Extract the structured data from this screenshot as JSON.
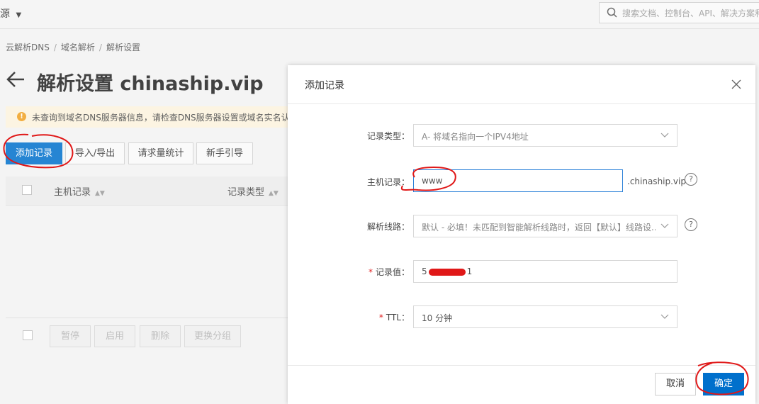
{
  "topbar": {
    "menu_label": "源",
    "search_placeholder": "搜索文档、控制台、API、解决方案和"
  },
  "breadcrumb": [
    "云解析DNS",
    "域名解析",
    "解析设置"
  ],
  "page_title": "解析设置 chinaship.vip",
  "notice": "未查询到域名DNS服务器信息，请检查DNS服务器设置或域名实名认",
  "toolbar": {
    "add_record": "添加记录",
    "import_export": "导入/导出",
    "request_stats": "请求量统计",
    "beginner_guide": "新手引导"
  },
  "table": {
    "columns": [
      "主机记录",
      "记录类型"
    ]
  },
  "batch": {
    "pause": "暂停",
    "enable": "启用",
    "delete": "删除",
    "change_group": "更换分组"
  },
  "dialog": {
    "title": "添加记录",
    "fields": {
      "record_type": {
        "label": "记录类型：",
        "value": "A- 将域名指向一个IPV4地址"
      },
      "host": {
        "label": "主机记录：",
        "value": "www",
        "suffix": ".chinaship.vip"
      },
      "line": {
        "label": "解析线路：",
        "value": "默认 - 必填！未匹配到智能解析线路时，返回【默认】线路设..."
      },
      "record_value": {
        "label": "记录值：",
        "value_prefix": "5",
        "value_suffix": "1"
      },
      "ttl": {
        "label": "TTL：",
        "value": "10 分钟"
      }
    },
    "cancel": "取消",
    "confirm": "确定"
  },
  "colors": {
    "primary": "#0070cc",
    "annotation": "#e01818",
    "required": "#e02020"
  }
}
